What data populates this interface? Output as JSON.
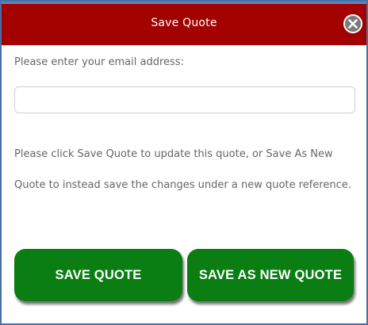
{
  "dialog": {
    "title": "Save Quote",
    "close_icon": "close-circle-x-icon"
  },
  "form": {
    "email_label": "Please enter your email address:",
    "email_value": "",
    "email_placeholder": ""
  },
  "info": {
    "text": "Please click Save Quote to update this quote, or Save As New Quote to instead save the changes under a new quote reference."
  },
  "buttons": {
    "save_label": "SAVE QUOTE",
    "save_as_new_label": "SAVE AS NEW QUOTE"
  },
  "colors": {
    "titlebar": "#a30000",
    "button": "#0a7d13",
    "border": "#4a6fa5"
  }
}
